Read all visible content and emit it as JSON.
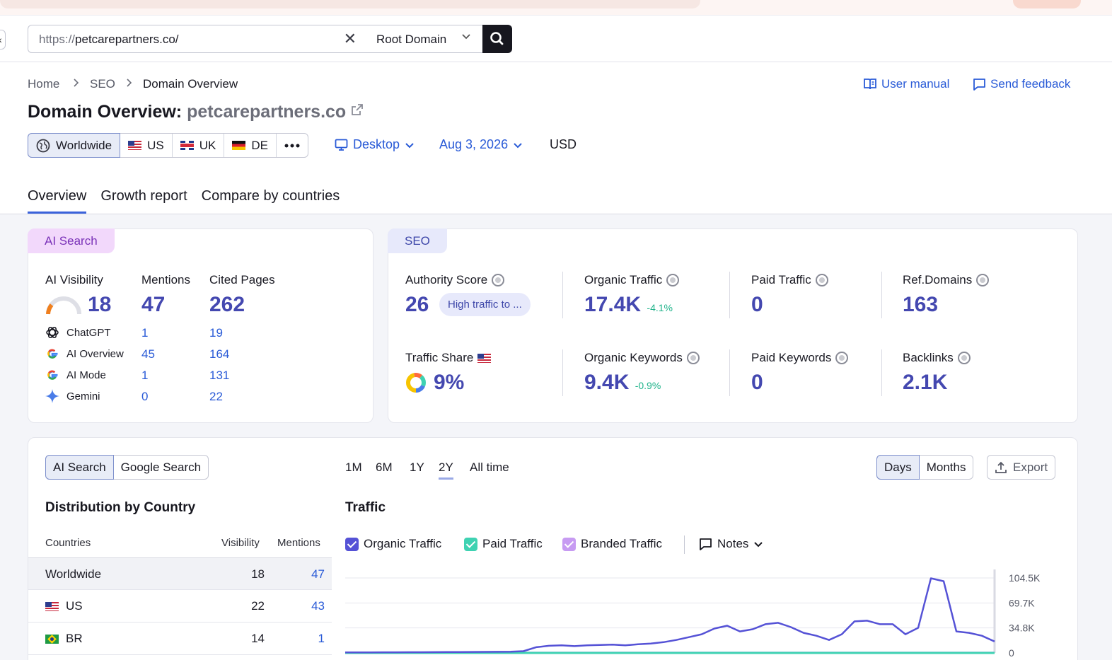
{
  "search": {
    "url_proto": "https://",
    "url_host": "petcarepartners.co/",
    "scope": "Root Domain"
  },
  "breadcrumb": [
    "Home",
    "SEO",
    "Domain Overview"
  ],
  "header": {
    "title_prefix": "Domain Overview:",
    "domain": "petcarepartners.co",
    "user_manual": "User manual",
    "send_feedback": "Send feedback"
  },
  "databases": [
    "Worldwide",
    "US",
    "UK",
    "DE"
  ],
  "controls": {
    "device": "Desktop",
    "date": "Aug 3, 2026",
    "currency": "USD"
  },
  "tabs": [
    "Overview",
    "Growth report",
    "Compare by countries"
  ],
  "ai_card": {
    "tag": "AI Search",
    "visibility_label": "AI Visibility",
    "visibility_value": "18",
    "mentions_label": "Mentions",
    "mentions_value": "47",
    "cited_label": "Cited Pages",
    "cited_value": "262",
    "platforms": [
      {
        "name": "ChatGPT",
        "mentions": "1",
        "cited": "19"
      },
      {
        "name": "AI Overview",
        "mentions": "45",
        "cited": "164"
      },
      {
        "name": "AI Mode",
        "mentions": "1",
        "cited": "131"
      },
      {
        "name": "Gemini",
        "mentions": "0",
        "cited": "22"
      }
    ]
  },
  "seo_card": {
    "tag": "SEO",
    "authority_label": "Authority Score",
    "authority_value": "26",
    "authority_badge": "High traffic to ...",
    "organic_traffic_label": "Organic Traffic",
    "organic_traffic_value": "17.4K",
    "organic_traffic_delta": "-4.1%",
    "paid_traffic_label": "Paid Traffic",
    "paid_traffic_value": "0",
    "ref_domains_label": "Ref.Domains",
    "ref_domains_value": "163",
    "traffic_share_label": "Traffic Share",
    "traffic_share_value": "9%",
    "organic_keywords_label": "Organic Keywords",
    "organic_keywords_value": "9.4K",
    "organic_keywords_delta": "-0.9%",
    "paid_keywords_label": "Paid Keywords",
    "paid_keywords_value": "0",
    "backlinks_label": "Backlinks",
    "backlinks_value": "2.1K"
  },
  "bottom": {
    "source_tabs": [
      "AI Search",
      "Google Search"
    ],
    "periods": [
      "1M",
      "6M",
      "1Y",
      "2Y",
      "All time"
    ],
    "active_period": "2Y",
    "granularity": [
      "Days",
      "Months"
    ],
    "export_label": "Export",
    "dist_title": "Distribution by Country",
    "table_headers": [
      "Countries",
      "Visibility",
      "Mentions"
    ],
    "rows": [
      {
        "country": "Worldwide",
        "visibility": "18",
        "mentions": "47"
      },
      {
        "country": "US",
        "visibility": "22",
        "mentions": "43"
      },
      {
        "country": "BR",
        "visibility": "14",
        "mentions": "1"
      }
    ],
    "traffic_title": "Traffic",
    "legend": [
      "Organic Traffic",
      "Paid Traffic",
      "Branded Traffic"
    ],
    "notes_label": "Notes",
    "colors": {
      "organic": "#5552d6",
      "paid": "#3fd2b2",
      "branded": "#c79bf2"
    }
  },
  "chart_data": {
    "type": "line",
    "title": "Traffic",
    "ylim": [
      0,
      104500
    ],
    "yticks": [
      "104.5K",
      "69.7K",
      "34.8K",
      "0"
    ],
    "series": [
      {
        "name": "Organic Traffic",
        "values": [
          800,
          800,
          800,
          900,
          900,
          1000,
          1000,
          1100,
          1200,
          1300,
          1400,
          1500,
          1600,
          1800,
          2500,
          8000,
          10000,
          10500,
          9500,
          10500,
          11000,
          11500,
          10500,
          12000,
          13000,
          15000,
          18000,
          22000,
          26000,
          34000,
          38000,
          30000,
          33000,
          40000,
          42000,
          36000,
          28000,
          24000,
          18000,
          26000,
          44000,
          45000,
          40000,
          40000,
          26000,
          35000,
          104000,
          100000,
          30000,
          28000,
          24000,
          16000
        ]
      },
      {
        "name": "Paid Traffic",
        "values": [
          0,
          0,
          0,
          0,
          0,
          0,
          0,
          0,
          0,
          0,
          0,
          0,
          0,
          0,
          0,
          0,
          0,
          0,
          0,
          0,
          0,
          0,
          0,
          0,
          0,
          0,
          0,
          0,
          0,
          0,
          0,
          0,
          0,
          0,
          0,
          0,
          0,
          0,
          0,
          0,
          0,
          0,
          0,
          0,
          0,
          0,
          0,
          0,
          0,
          0,
          0,
          0
        ]
      },
      {
        "name": "Branded Traffic",
        "values": [
          200,
          200,
          200,
          200,
          200,
          200,
          200,
          200,
          200,
          200,
          200,
          200,
          200,
          200,
          200,
          200,
          200,
          200,
          200,
          200,
          200,
          200,
          200,
          200,
          200,
          200,
          200,
          200,
          200,
          200,
          200,
          200,
          200,
          200,
          200,
          200,
          200,
          200,
          200,
          200,
          200,
          200,
          200,
          200,
          200,
          200,
          200,
          200,
          200,
          200,
          200,
          200
        ]
      }
    ]
  }
}
